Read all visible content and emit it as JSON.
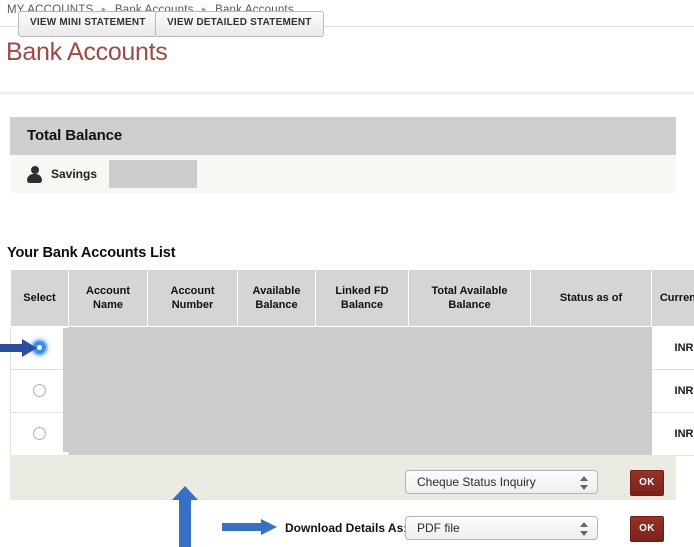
{
  "breadcrumb": {
    "separator": "▸",
    "items": [
      "MY ACCOUNTS",
      "Bank Accounts",
      "Bank Accounts"
    ]
  },
  "page": {
    "title": "Bank Accounts",
    "title_color": "#9d4a42"
  },
  "total_balance": {
    "header": "Total Balance",
    "account_type": "Savings",
    "amount": "",
    "amount_redacted": true,
    "icon": "person-icon"
  },
  "accounts_list": {
    "heading": "Your Bank Accounts List",
    "columns": [
      "Select",
      "Account Name",
      "Account Number",
      "Available Balance",
      "Linked FD Balance",
      "Total Available Balance",
      "Status as of",
      "Currency"
    ],
    "rows": [
      {
        "selected": true,
        "account_name": "",
        "account_number": "",
        "available_balance": "",
        "linked_fd_balance": "",
        "total_available_balance": "",
        "status_as_of": "",
        "currency": "INR"
      },
      {
        "selected": false,
        "account_name": "",
        "account_number": "",
        "available_balance": "",
        "linked_fd_balance": "",
        "total_available_balance": "",
        "status_as_of": "",
        "currency": "INR"
      },
      {
        "selected": false,
        "account_name": "",
        "account_number": "",
        "available_balance": "",
        "linked_fd_balance": "",
        "total_available_balance": "",
        "status_as_of": "",
        "currency": "INR"
      }
    ],
    "data_redacted": true
  },
  "actions": {
    "view_mini_statement": "VIEW MINI STATEMENT",
    "view_detailed_statement": "VIEW DETAILED STATEMENT",
    "inquiry_select_value": "Cheque Status Inquiry",
    "inquiry_ok": "OK",
    "download_label": "Download Details As:",
    "download_select_value": "PDF file",
    "download_ok": "OK",
    "ok_button_color": "#8c2a22"
  },
  "annotations": {
    "arrow_to_radio_color": "#2b4f9e",
    "arrow_to_detailed_statement_color": "#3871c4",
    "arrow_to_download_color": "#3871c4"
  }
}
